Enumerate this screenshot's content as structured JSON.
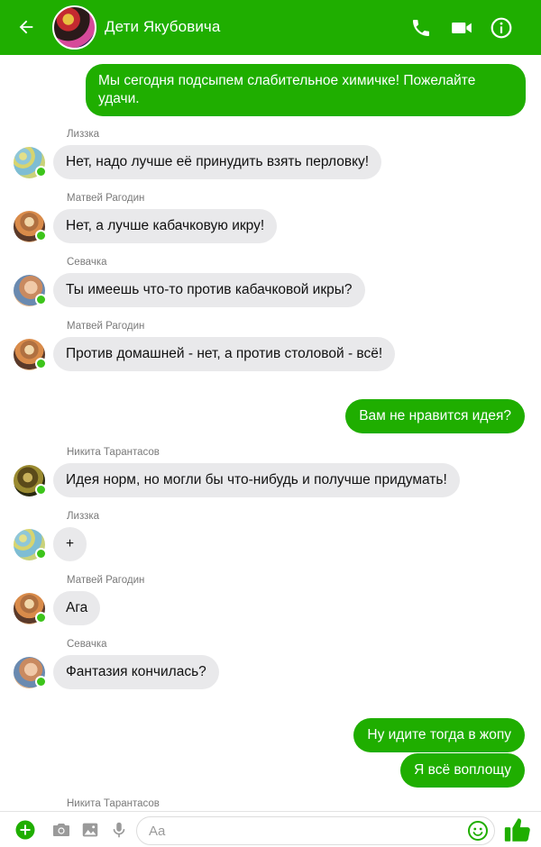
{
  "header": {
    "title": "Дети Якубовича",
    "back_icon": "arrow-left-icon",
    "call_icon": "phone-icon",
    "video_icon": "video-camera-icon",
    "info_icon": "info-icon",
    "bg_color": "#1fae00"
  },
  "messages": [
    {
      "id": "m1",
      "direction": "out",
      "text": "Мы сегодня подсыпем слабительное химичке! Пожелайте удачи."
    },
    {
      "id": "m2",
      "direction": "in",
      "sender": "Лиззка",
      "text": "Нет, надо лучше её принудить взять перловку!"
    },
    {
      "id": "m3",
      "direction": "in",
      "sender": "Матвей Рагодин",
      "text": "Нет, а лучше кабачковую икру!"
    },
    {
      "id": "m4",
      "direction": "in",
      "sender": "Севачка",
      "text": "Ты имеешь что-то против кабачковой икры?"
    },
    {
      "id": "m5",
      "direction": "in",
      "sender": "Матвей Рагодин",
      "text": "Против домашней - нет, а против столовой - всё!"
    },
    {
      "id": "m6",
      "direction": "out",
      "text": "Вам не нравится идея?"
    },
    {
      "id": "m7",
      "direction": "in",
      "sender": "Никита Тарантасов",
      "text": "Идея норм, но могли бы что-нибудь и получше придумать!"
    },
    {
      "id": "m8",
      "direction": "in",
      "sender": "Лиззка",
      "text": "+"
    },
    {
      "id": "m9",
      "direction": "in",
      "sender": "Матвей Рагодин",
      "text": "Ага"
    },
    {
      "id": "m10",
      "direction": "in",
      "sender": "Севачка",
      "text": "Фантазия кончилась?"
    },
    {
      "id": "m11",
      "direction": "out",
      "text": "Ну идите тогда в жопу"
    },
    {
      "id": "m12",
      "direction": "out",
      "text": "Я всё воплощу"
    },
    {
      "id": "m13",
      "direction": "in",
      "sender": "Никита Тарантасов",
      "text": ""
    }
  ],
  "composer": {
    "placeholder": "Aa",
    "plus_icon": "plus-circle-icon",
    "camera_icon": "camera-icon",
    "gallery_icon": "image-icon",
    "mic_icon": "microphone-icon",
    "emoji_icon": "smiley-icon",
    "like_icon": "thumbs-up-icon",
    "accent_color": "#1fae00"
  }
}
